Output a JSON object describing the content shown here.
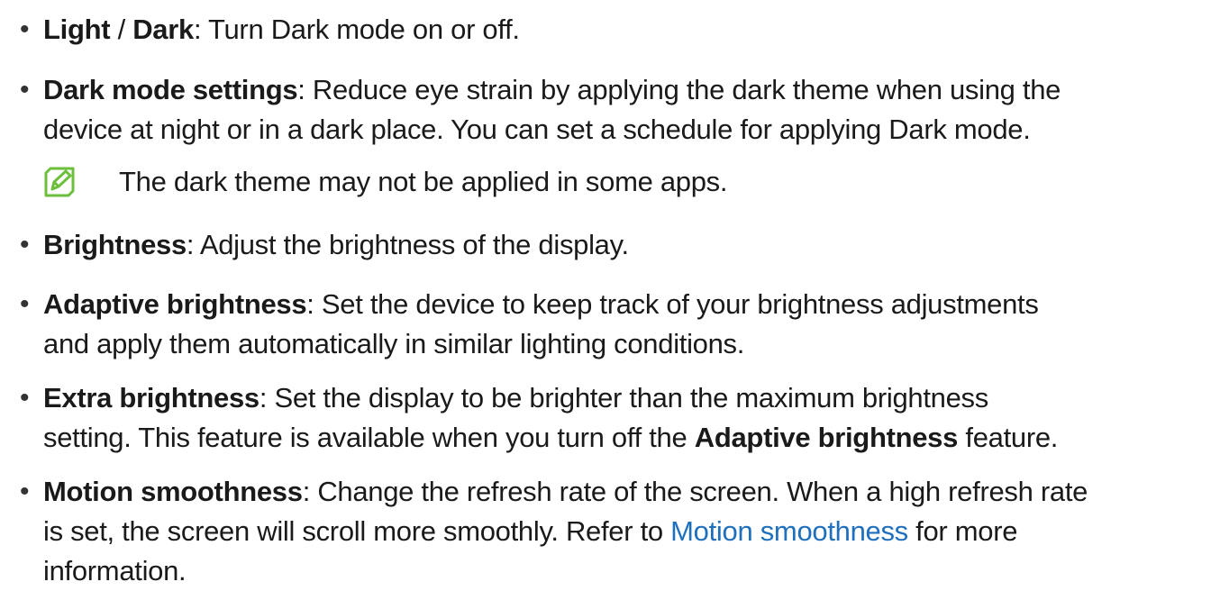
{
  "colors": {
    "text": "#1a1a1a",
    "link": "#1f6fbf",
    "note_icon": "#6bbf3a"
  },
  "bullet_glyph": "•",
  "items": [
    {
      "line1": {
        "term": "Light",
        "sep": " / ",
        "term2": "Dark",
        "rest": ": Turn Dark mode on or off."
      }
    },
    {
      "line1": {
        "term": "Dark mode settings",
        "rest": ": Reduce eye strain by applying the dark theme when using the"
      },
      "line2": "device at night or in a dark place. You can set a schedule for applying Dark mode."
    },
    {
      "line1": {
        "term": "Brightness",
        "rest": ": Adjust the brightness of the display."
      }
    },
    {
      "line1": {
        "term": "Adaptive brightness",
        "rest": ": Set the device to keep track of your brightness adjustments"
      },
      "line2": "and apply them automatically in similar lighting conditions."
    },
    {
      "line1": {
        "term": "Extra brightness",
        "rest": ": Set the display to be brighter than the maximum brightness"
      },
      "line2": {
        "pre": "setting. This feature is available when you turn off the ",
        "term": "Adaptive brightness",
        "post": " feature."
      }
    },
    {
      "line1": {
        "term": "Motion smoothness",
        "rest": ": Change the refresh rate of the screen. When a high refresh rate"
      },
      "line2": {
        "pre": "is set, the screen will scroll more smoothly. Refer to ",
        "link": "Motion smoothness",
        "post": " for more"
      },
      "line3": "information."
    }
  ],
  "note": {
    "icon": "note-pen-icon",
    "text": "The dark theme may not be applied in some apps."
  }
}
